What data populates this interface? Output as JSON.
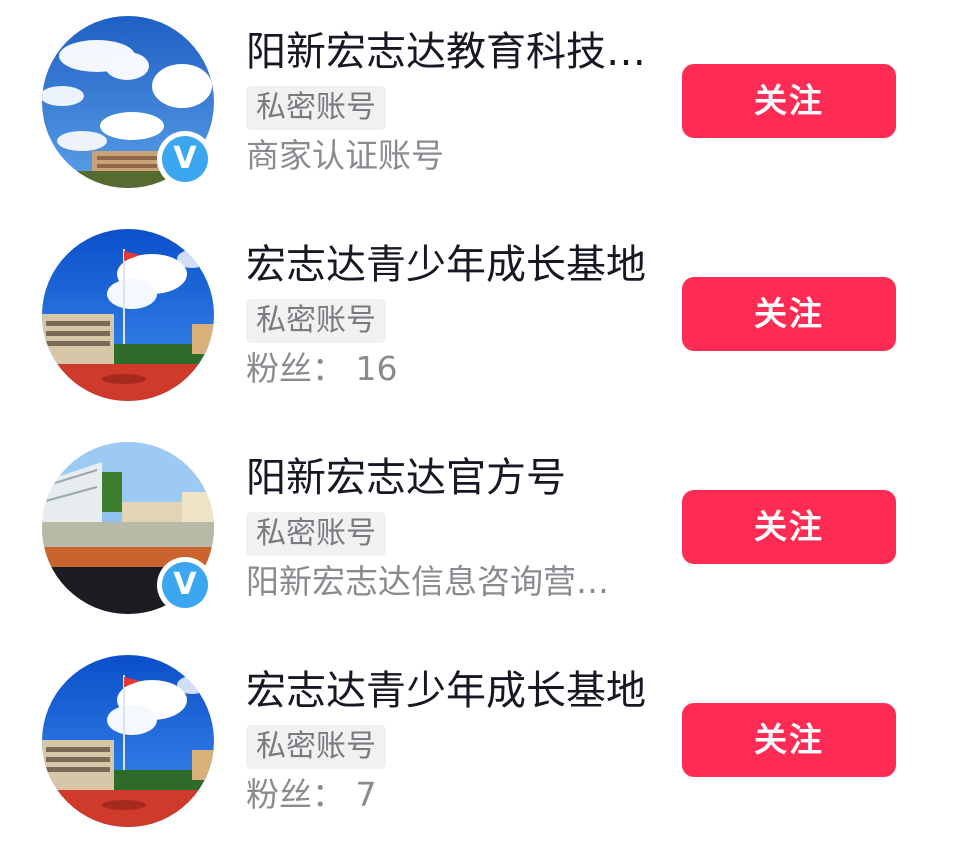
{
  "accounts": [
    {
      "name": "阳新宏志达教育科技…",
      "tag": "私密账号",
      "subtitle": "商家认证账号",
      "verified": true,
      "follow_label": "关注",
      "avatar_icon": "school-campus-sky-avatar"
    },
    {
      "name": "宏志达青少年成长基地",
      "tag": "私密账号",
      "subtitle": "粉丝： 16",
      "verified": false,
      "follow_label": "关注",
      "avatar_icon": "flag-sky-avatar"
    },
    {
      "name": "阳新宏志达官方号",
      "tag": "私密账号",
      "subtitle": "阳新宏志达信息咨询营…",
      "verified": true,
      "follow_label": "关注",
      "avatar_icon": "stadium-track-avatar"
    },
    {
      "name": "宏志达青少年成长基地",
      "tag": "私密账号",
      "subtitle": "粉丝： 7",
      "verified": false,
      "follow_label": "关注",
      "avatar_icon": "flag-sky-avatar"
    }
  ],
  "colors": {
    "follow_button": "#fe2c55",
    "verified_badge": "#3ba7f0",
    "title_text": "#161823",
    "secondary_text": "#8a8b90"
  }
}
